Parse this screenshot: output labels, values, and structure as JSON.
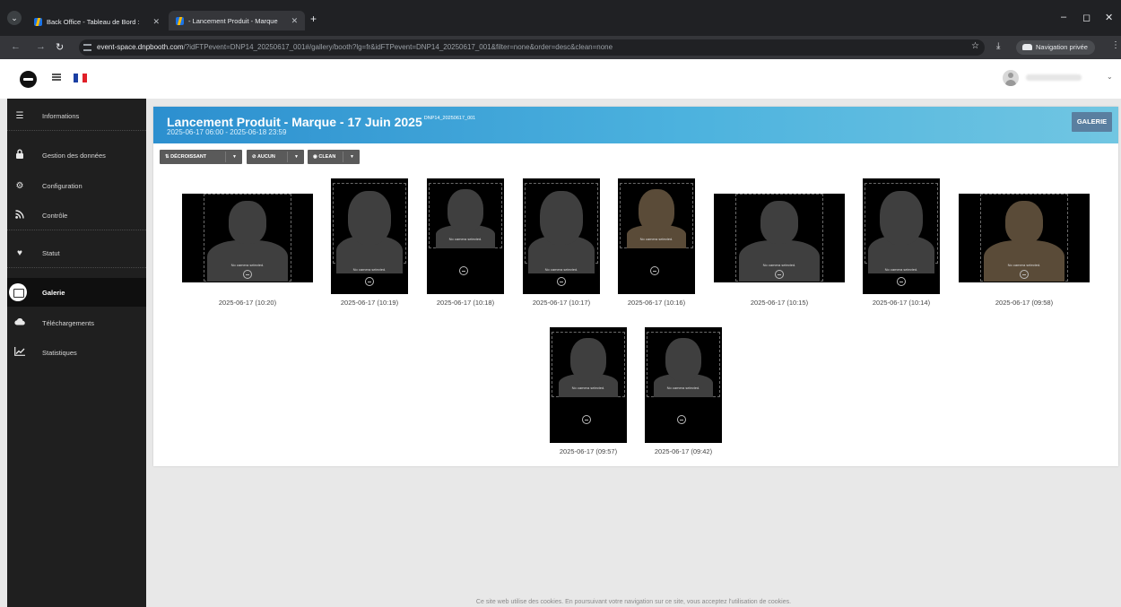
{
  "browser": {
    "tabs": [
      {
        "title": "Back Office - Tableau de Bord :",
        "active": false
      },
      {
        "title": " - Lancement Produit - Marque",
        "active": true
      }
    ],
    "url_host": "event-space.dnpbooth.com",
    "url_rest": "/?idFTPevent=DNP14_20250617_001#/gallery/booth?lg=fr&idFTPevent=DNP14_20250617_001&filter=none&order=desc&clean=none",
    "incognito_label": "Navigation privée"
  },
  "sidebar": {
    "items": [
      {
        "label": "Informations",
        "icon": "list-icon"
      },
      {
        "label": "Gestion des données",
        "icon": "lock-icon"
      },
      {
        "label": "Configuration",
        "icon": "gears-icon"
      },
      {
        "label": "Contrôle",
        "icon": "rss-icon"
      },
      {
        "label": "Statut",
        "icon": "heartbeat-icon"
      },
      {
        "label": "Galerie",
        "icon": "image-icon"
      },
      {
        "label": "Téléchargements",
        "icon": "cloud-icon"
      },
      {
        "label": "Statistiques",
        "icon": "line-chart-icon"
      }
    ]
  },
  "main": {
    "title": "Lancement Produit - Marque - 17 Juin 2025",
    "event_code": "DNP14_20250617_001",
    "date_range": "2025-06-17 06:00 - 2025-06-18 23:59",
    "galerie_button": "GALERIE",
    "toolbar": {
      "order_label": "DÉCROISSANT",
      "filter_label": "AUCUN",
      "clean_label": "CLEAN"
    },
    "gallery": [
      {
        "caption": "2025-06-17 (10:20)",
        "message": "No camera selected.",
        "tint": "gray"
      },
      {
        "caption": "2025-06-17 (10:19)",
        "message": "No camera selected.",
        "tint": "gray"
      },
      {
        "caption": "2025-06-17 (10:18)",
        "message": "No camera selected.",
        "tint": "gray"
      },
      {
        "caption": "2025-06-17 (10:17)",
        "message": "No camera selected.",
        "tint": "gray"
      },
      {
        "caption": "2025-06-17 (10:16)",
        "message": "No camera selected.",
        "tint": "brown"
      },
      {
        "caption": "2025-06-17 (10:15)",
        "message": "No camera selected.",
        "tint": "gray"
      },
      {
        "caption": "2025-06-17 (10:14)",
        "message": "No camera selected.",
        "tint": "gray"
      },
      {
        "caption": "2025-06-17 (09:58)",
        "message": "No camera selected.",
        "tint": "brown"
      },
      {
        "caption": "2025-06-17 (09:57)",
        "message": "No camera selected.",
        "tint": "gray"
      },
      {
        "caption": "2025-06-17 (09:42)",
        "message": "No camera selected.",
        "tint": "gray"
      }
    ]
  },
  "footer": {
    "cookie_text": "Ce site web utilise des cookies. En poursuivant votre navigation sur ce site, vous acceptez l'utilisation de cookies."
  },
  "colors": {
    "banner_start": "#2c8fcf",
    "banner_end": "#71c6e2",
    "sidebar_bg": "#1f1f1f",
    "silhouette_gray": "#3f3f3f",
    "silhouette_brown": "#5a4b38"
  }
}
